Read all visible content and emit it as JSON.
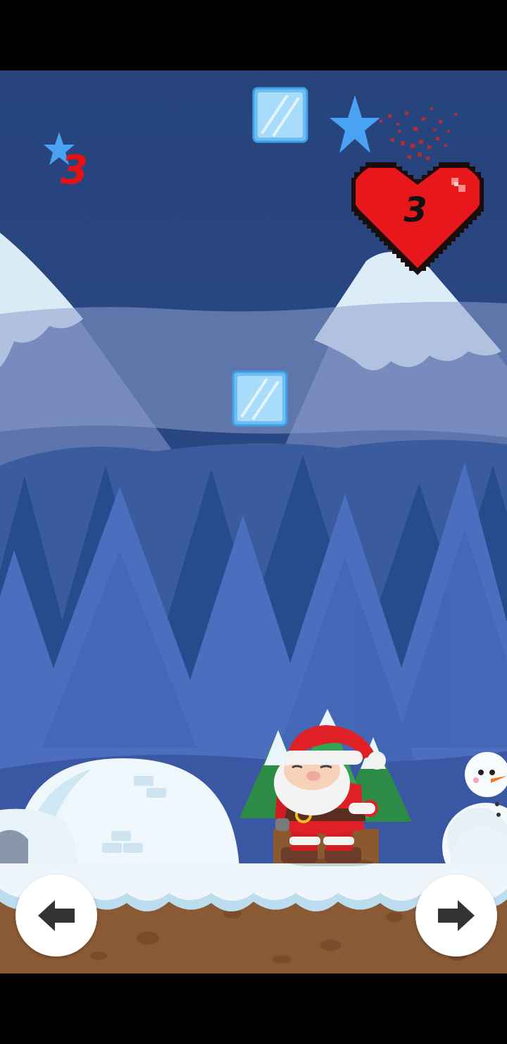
{
  "hud": {
    "star_score": "3",
    "lives": "3"
  },
  "icons": {
    "score": "star-icon",
    "lives": "heart-icon",
    "left": "arrow-left-icon",
    "right": "arrow-right-icon"
  },
  "colors": {
    "sky": "#27467f",
    "heart": "#e8171b",
    "star": "#4aa3f2",
    "score_text": "#e61212",
    "ice_block": "#8fd0f7"
  }
}
